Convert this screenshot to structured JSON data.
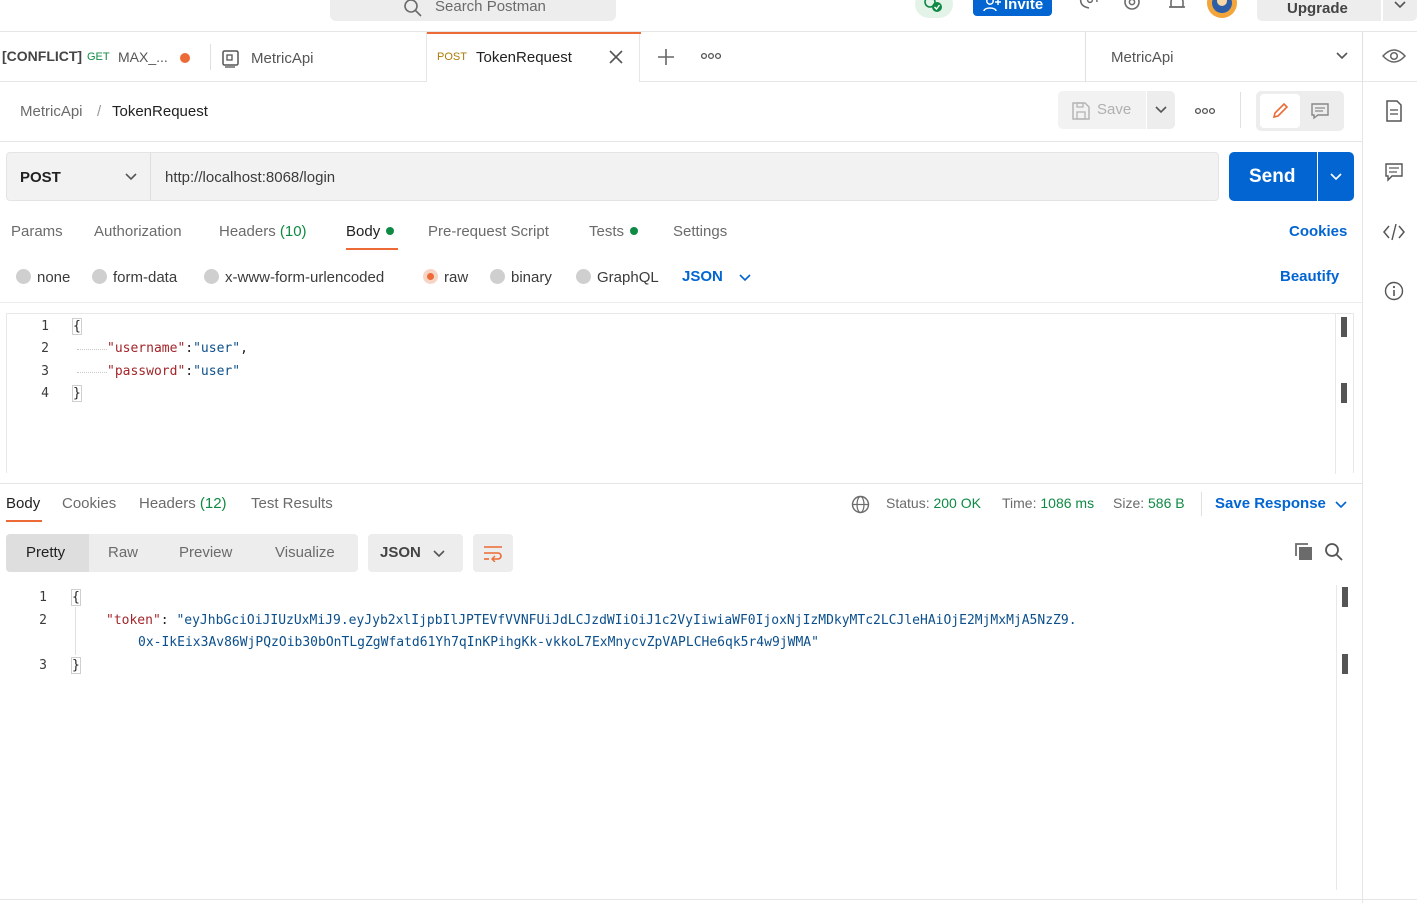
{
  "topbar": {
    "search_placeholder": "Search Postman",
    "invite_label": "Invite",
    "upgrade_label": "Upgrade"
  },
  "tabs": [
    {
      "prefix": "[CONFLICT]",
      "method": "GET",
      "label": "MAX_...",
      "unsaved": true
    },
    {
      "label": "MetricApi",
      "kind": "collection"
    },
    {
      "method": "POST",
      "label": "TokenRequest",
      "active": true
    }
  ],
  "environment": {
    "selected": "MetricApi"
  },
  "breadcrumb": {
    "parent": "MetricApi",
    "separator": "/",
    "current": "TokenRequest"
  },
  "actions": {
    "save_label": "Save"
  },
  "request": {
    "method": "POST",
    "url": "http://localhost:8068/login",
    "send_label": "Send",
    "tabs": {
      "params": "Params",
      "authorization": "Authorization",
      "headers": "Headers",
      "headers_count": "(10)",
      "body": "Body",
      "prerequest": "Pre-request Script",
      "tests": "Tests",
      "settings": "Settings"
    },
    "cookies_label": "Cookies",
    "body_types": [
      "none",
      "form-data",
      "x-www-form-urlencoded",
      "raw",
      "binary",
      "GraphQL"
    ],
    "body_type_selected": "raw",
    "language": "JSON",
    "beautify_label": "Beautify",
    "body_lines": {
      "n1": "1",
      "n2": "2",
      "n3": "3",
      "n4": "4",
      "l1": "{",
      "l2_key": "\"username\"",
      "l2_colon": ":",
      "l2_val": "\"user\"",
      "l2_end": ",",
      "l3_key": "\"password\"",
      "l3_colon": ":",
      "l3_val": "\"user\"",
      "l4": "}"
    }
  },
  "response": {
    "tabs": {
      "body": "Body",
      "cookies": "Cookies",
      "headers": "Headers",
      "headers_count": "(12)",
      "test_results": "Test Results"
    },
    "status_label": "Status:",
    "status_value": "200 OK",
    "time_label": "Time:",
    "time_value": "1086 ms",
    "size_label": "Size:",
    "size_value": "586 B",
    "save_response_label": "Save Response",
    "views": [
      "Pretty",
      "Raw",
      "Preview",
      "Visualize"
    ],
    "view_selected": "Pretty",
    "format": "JSON",
    "body_lines": {
      "n1": "1",
      "n2": "2",
      "n3": "3",
      "l1": "{",
      "l2_key": "\"token\"",
      "l2_colon": ":",
      "l2_val_a": "\"eyJhbGciOiJIUzUxMiJ9.eyJyb2xlIjpbIlJPTEVfVVNFUiJdLCJzdWIiOiJ1c2VyIiwiaWF0IjoxNjIzMDkyMTc2LCJleHAiOjE2MjMxMjA5NzZ9.",
      "l2_val_b": "0x-IkEix3Av86WjPQzOib30bOnTLgZgWfatd61Yh7qInKPihgKk-vkkoL7ExMnycvZpVAPLCHe6qk5r4w9jWMA\"",
      "l3": "}"
    }
  },
  "colors": {
    "accent_blue": "#0265d2",
    "accent_orange": "#ec6a35",
    "success_green": "#0f8a44",
    "key_red": "#a3262a",
    "string_blue": "#0b4f8c"
  }
}
